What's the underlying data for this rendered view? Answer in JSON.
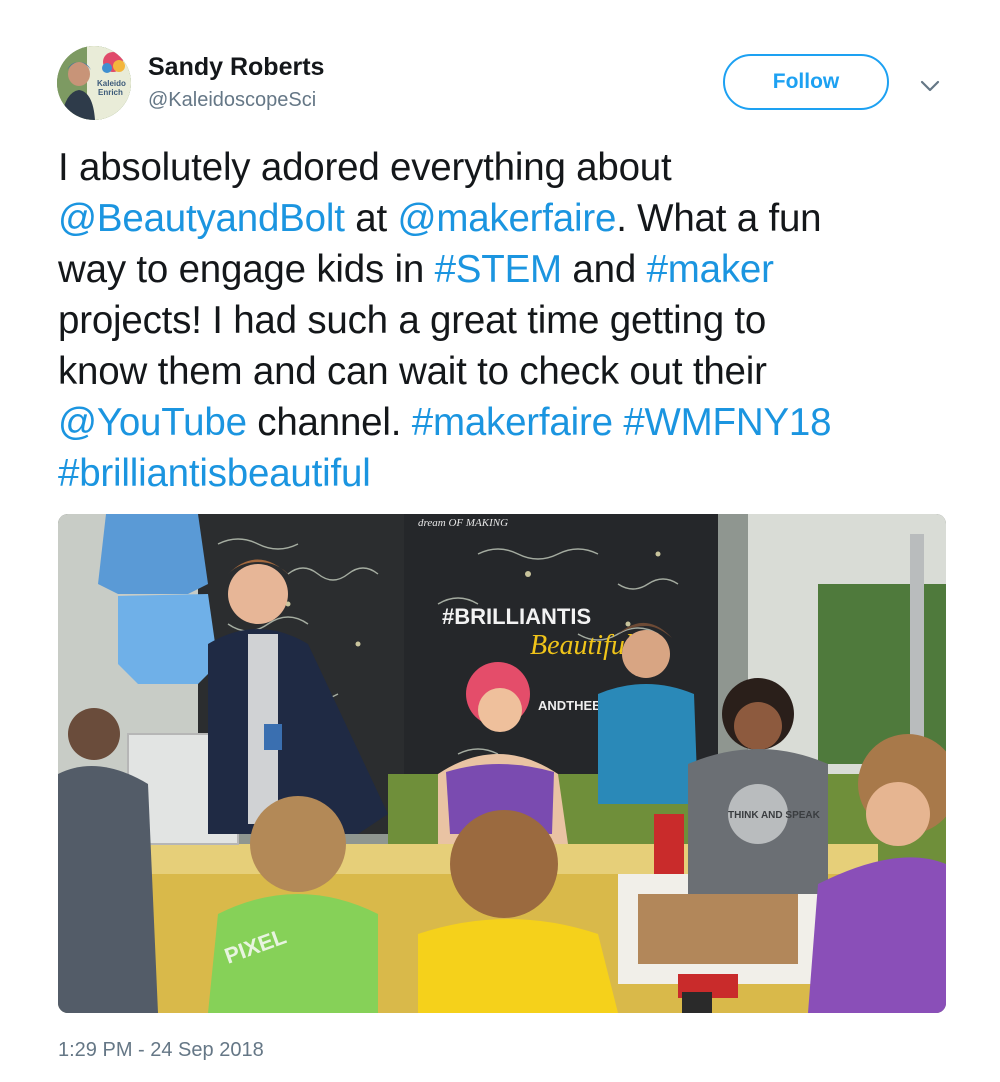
{
  "user": {
    "display_name": "Sandy Roberts",
    "handle": "@KaleidoscopeSci",
    "avatar_text": [
      "Kaleido",
      "Enrich"
    ]
  },
  "actions": {
    "follow_label": "Follow",
    "menu_icon": "chevron-down-icon"
  },
  "tweet": {
    "lines": [
      [
        {
          "t": "I absolutely adored everything about",
          "link": false
        }
      ],
      [
        {
          "t": "@BeautyandBolt",
          "link": true
        },
        {
          "t": " at ",
          "link": false
        },
        {
          "t": "@makerfaire",
          "link": true
        },
        {
          "t": ". What a fun",
          "link": false
        }
      ],
      [
        {
          "t": "way to engage kids in ",
          "link": false
        },
        {
          "t": "#STEM",
          "link": true
        },
        {
          "t": " and ",
          "link": false
        },
        {
          "t": "#maker",
          "link": true
        }
      ],
      [
        {
          "t": "projects! I had such a great time getting to",
          "link": false
        }
      ],
      [
        {
          "t": "know them and can wait to check out their",
          "link": false
        }
      ],
      [
        {
          "t": "@YouTube",
          "link": true
        },
        {
          "t": " channel. ",
          "link": false
        },
        {
          "t": "#makerfaire",
          "link": true
        },
        {
          "t": " ",
          "link": false
        },
        {
          "t": "#WMFNY18",
          "link": true
        }
      ],
      [
        {
          "t": "#brilliantisbeautiful",
          "link": true
        }
      ]
    ]
  },
  "photo": {
    "wall_text_top": "dream OF MAKING",
    "wall_text_main": "#BRILLIANTIS",
    "wall_text_script": "Beautiful",
    "wall_text_bottom": "ANDTHEBOLT",
    "shirt_text_left": "PIXEL",
    "shirt_text_right": "THINK AND SPEAK"
  },
  "timestamp": "1:29 PM - 24 Sep 2018",
  "colors": {
    "link": "#1b95e0",
    "follow_border": "#1da1f2",
    "muted": "#657786",
    "text": "#14171a"
  }
}
